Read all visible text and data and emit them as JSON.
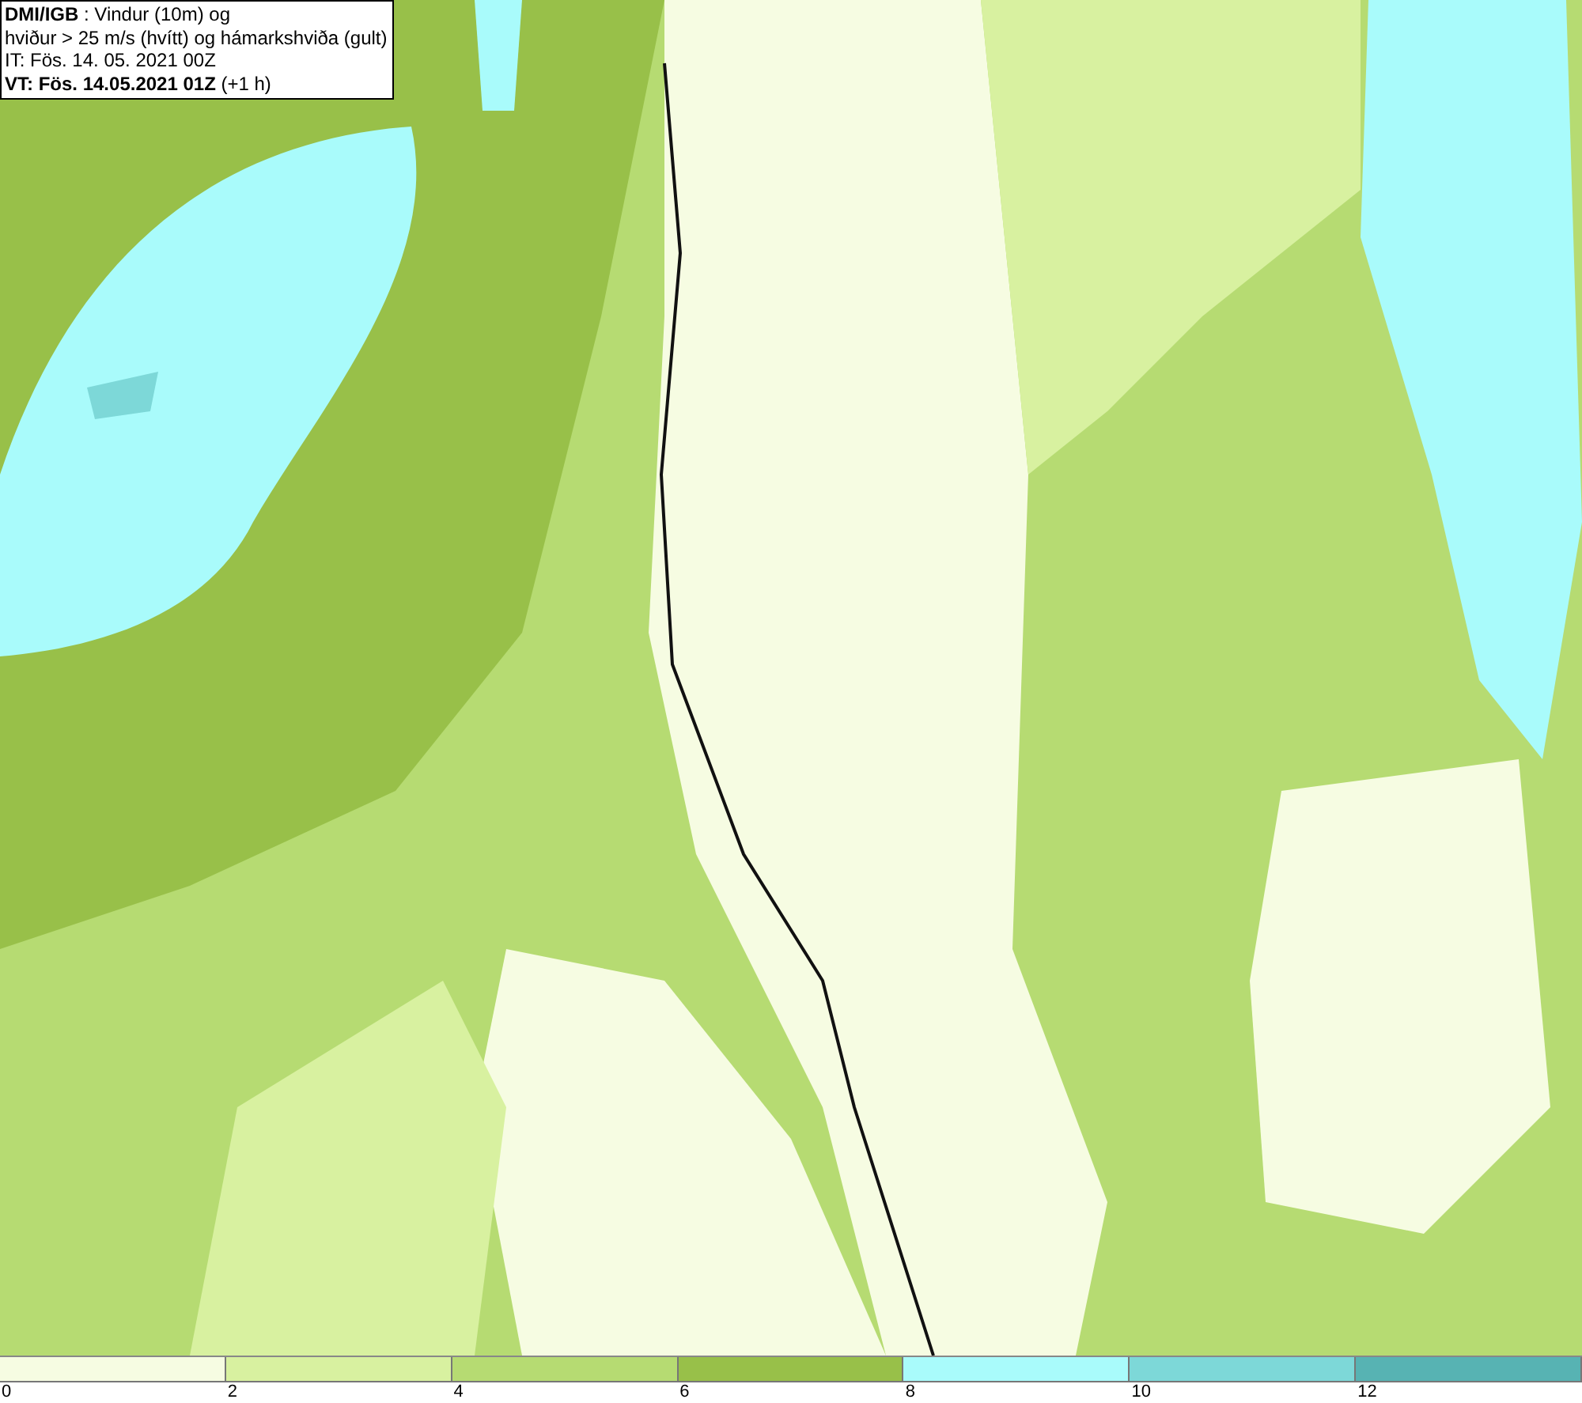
{
  "header": {
    "lines": [
      "**DMI/IGB** : Vindur (10m) og",
      "hviður > 25 m/s (hvítt) og hámarkshviða (gult)",
      "IT: Fös. 14. 05. 2021 00Z",
      "**VT: Fös. 14.05.2021 01Z** (+1 h)"
    ]
  },
  "legend": {
    "bins": [
      {
        "color": "#f6fce2",
        "tick": "0"
      },
      {
        "color": "#d8f1a0",
        "tick": "2"
      },
      {
        "color": "#b6db72",
        "tick": "4"
      },
      {
        "color": "#98c049",
        "tick": "6"
      },
      {
        "color": "#a9fbfb",
        "tick": "8"
      },
      {
        "color": "#7dd8d8",
        "tick": "10"
      },
      {
        "color": "#57b3b3",
        "tick": "12"
      }
    ]
  }
}
